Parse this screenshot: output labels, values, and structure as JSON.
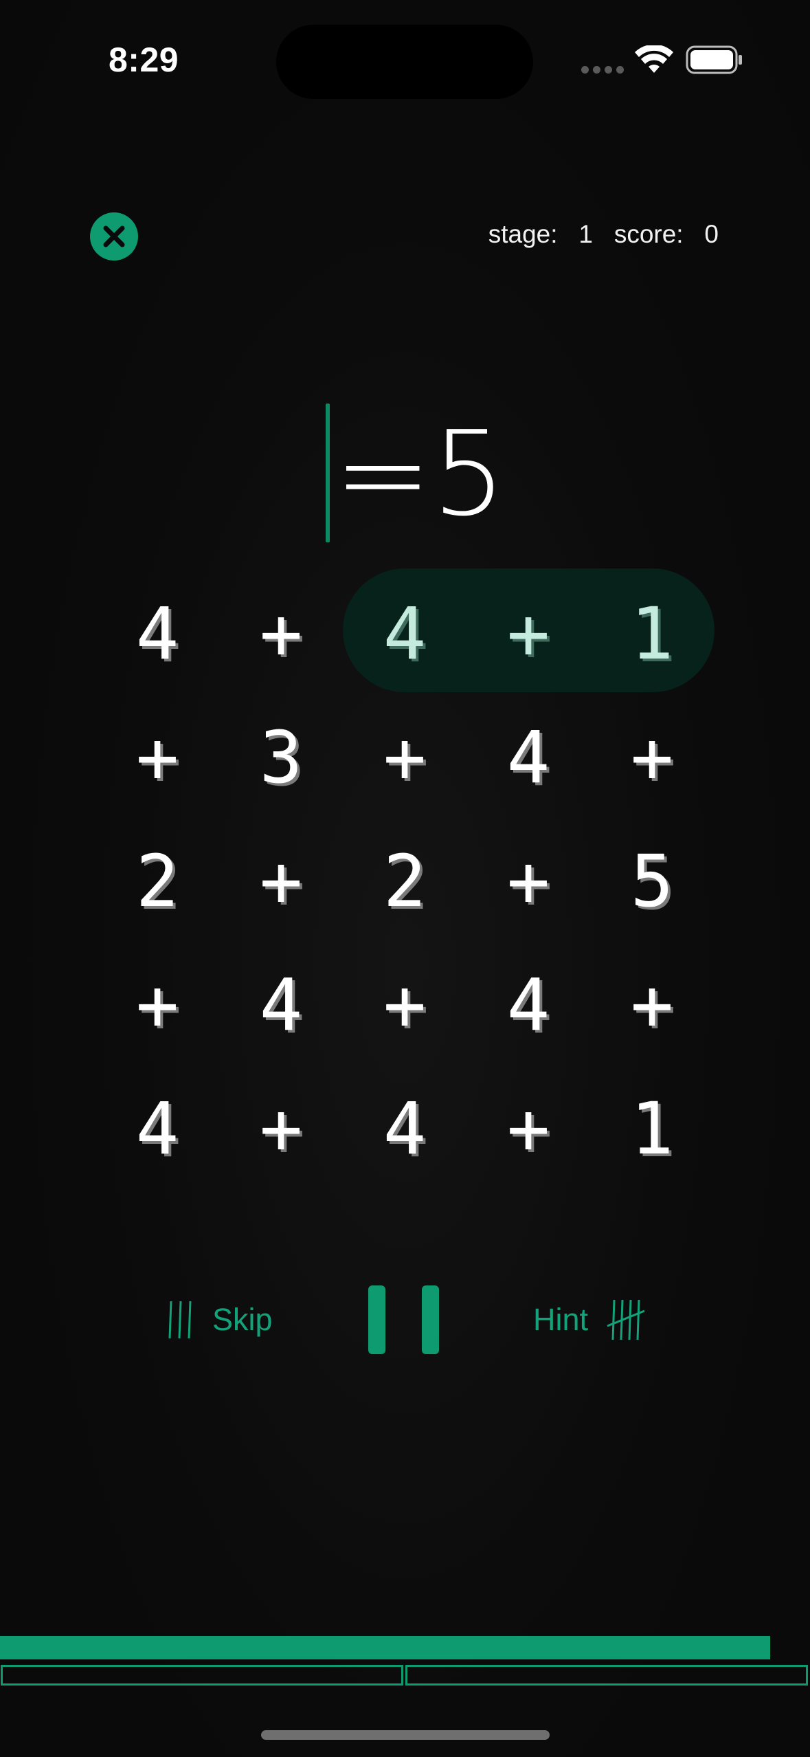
{
  "status_bar": {
    "time": "8:29"
  },
  "header": {
    "stage_label": "stage:",
    "stage_value": "1",
    "score_label": "score:",
    "score_value": "0"
  },
  "equation": {
    "target": "=5"
  },
  "grid": {
    "rows": [
      [
        "4",
        "+",
        "4",
        "+",
        "1"
      ],
      [
        "+",
        "3",
        "+",
        "4",
        "+"
      ],
      [
        "2",
        "+",
        "2",
        "+",
        "5"
      ],
      [
        "+",
        "4",
        "+",
        "4",
        "+"
      ],
      [
        "4",
        "+",
        "4",
        "+",
        "1"
      ]
    ],
    "selected": [
      [
        0,
        2
      ],
      [
        0,
        3
      ],
      [
        0,
        4
      ]
    ]
  },
  "controls": {
    "skip_label": "Skip",
    "hint_label": "Hint"
  },
  "progress": {
    "time_remaining_fraction": 0.95,
    "segments_total": 2,
    "segments_completed": 0
  },
  "colors": {
    "accent": "#0e9b70",
    "background": "#0b0b0b",
    "highlight": "#06221a",
    "selected_text": "#c5eade"
  },
  "icons": {
    "close": "close-icon",
    "skip": "tally-three-icon",
    "pause": "pause-icon",
    "hint": "tally-five-icon"
  }
}
